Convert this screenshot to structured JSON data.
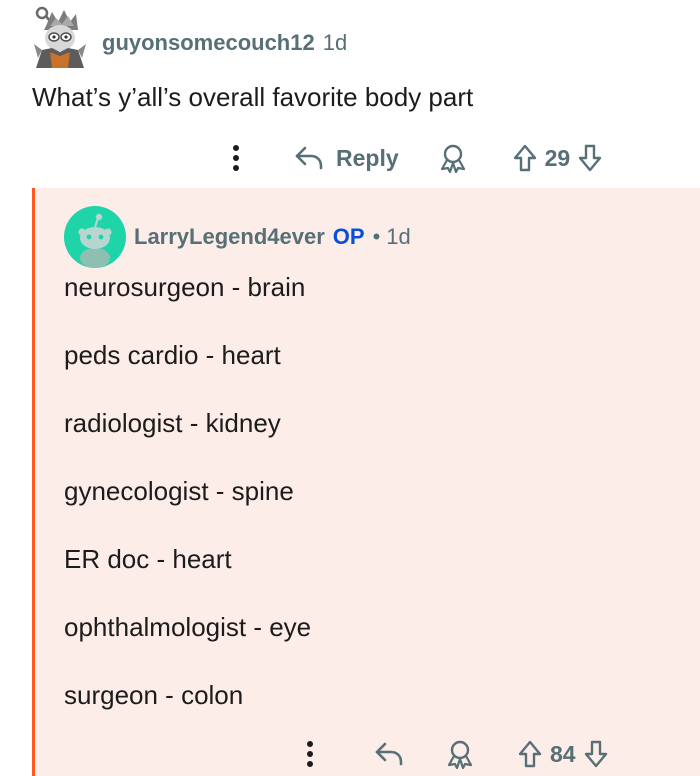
{
  "parent_comment": {
    "username": "guyonsomecouch12",
    "time": "1d",
    "text": "What’s y’all’s overall favorite body part",
    "actions": {
      "reply_label": "Reply",
      "score": "29"
    }
  },
  "reply_comment": {
    "username": "LarryLegend4ever",
    "op_badge": "OP",
    "separator": "•",
    "time": "1d",
    "lines": [
      "neurosurgeon - brain",
      "peds cardio - heart",
      "radiologist - kidney",
      "gynecologist - spine",
      "ER doc - heart",
      "ophthalmologist - eye",
      "surgeon - colon"
    ],
    "actions": {
      "score": "84"
    }
  },
  "colors": {
    "thread_line": "#ff5722",
    "reply_background": "#fdede8",
    "op_badge": "#0a4fd6",
    "meta_text": "#576f76",
    "avatar_2_bg": "#1fd4a8"
  },
  "icons": {
    "more": "more-vertical-icon",
    "reply": "reply-arrow-icon",
    "award": "award-ribbon-icon",
    "upvote": "upvote-arrow-icon",
    "downvote": "downvote-arrow-icon"
  }
}
